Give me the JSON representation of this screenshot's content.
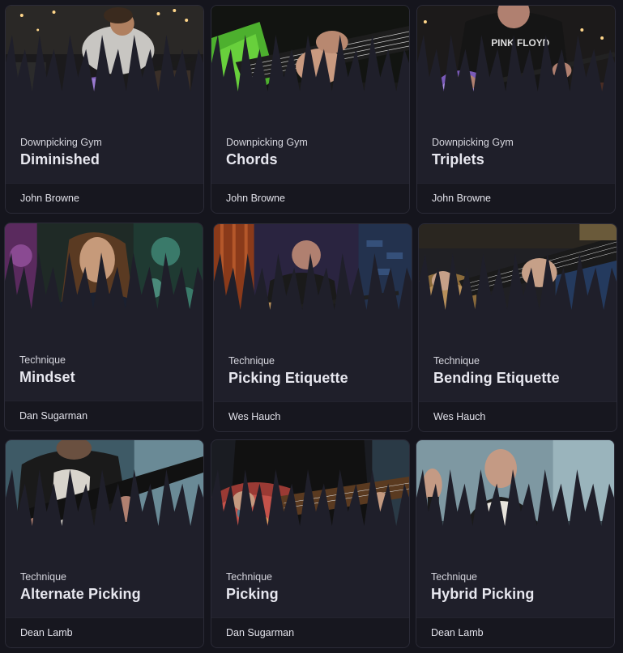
{
  "courses": [
    {
      "category": "Downpicking Gym",
      "title": "Diminished",
      "author": "John Browne",
      "thumb": "guitarist-purple-guitar-icon"
    },
    {
      "category": "Downpicking Gym",
      "title": "Chords",
      "author": "John Browne",
      "thumb": "green-guitar-closeup-icon"
    },
    {
      "category": "Downpicking Gym",
      "title": "Triplets",
      "author": "John Browne",
      "thumb": "guitarist-pink-floyd-shirt-icon"
    },
    {
      "category": "Technique",
      "title": "Mindset",
      "author": "Dan Sugarman",
      "thumb": "presenter-green-backdrop-icon"
    },
    {
      "category": "Technique",
      "title": "Picking Etiquette",
      "author": "Wes Hauch",
      "thumb": "guitarist-brick-wall-icon"
    },
    {
      "category": "Technique",
      "title": "Bending Etiquette",
      "author": "Wes Hauch",
      "thumb": "guitar-neck-bending-icon"
    },
    {
      "category": "Technique",
      "title": "Alternate Picking",
      "author": "Dean Lamb",
      "thumb": "guitarist-black-guitar-icon"
    },
    {
      "category": "Technique",
      "title": "Picking",
      "author": "Dan Sugarman",
      "thumb": "red-swirl-guitar-icon"
    },
    {
      "category": "Technique",
      "title": "Hybrid Picking",
      "author": "Dean Lamb",
      "thumb": "presenter-waving-icon"
    }
  ]
}
